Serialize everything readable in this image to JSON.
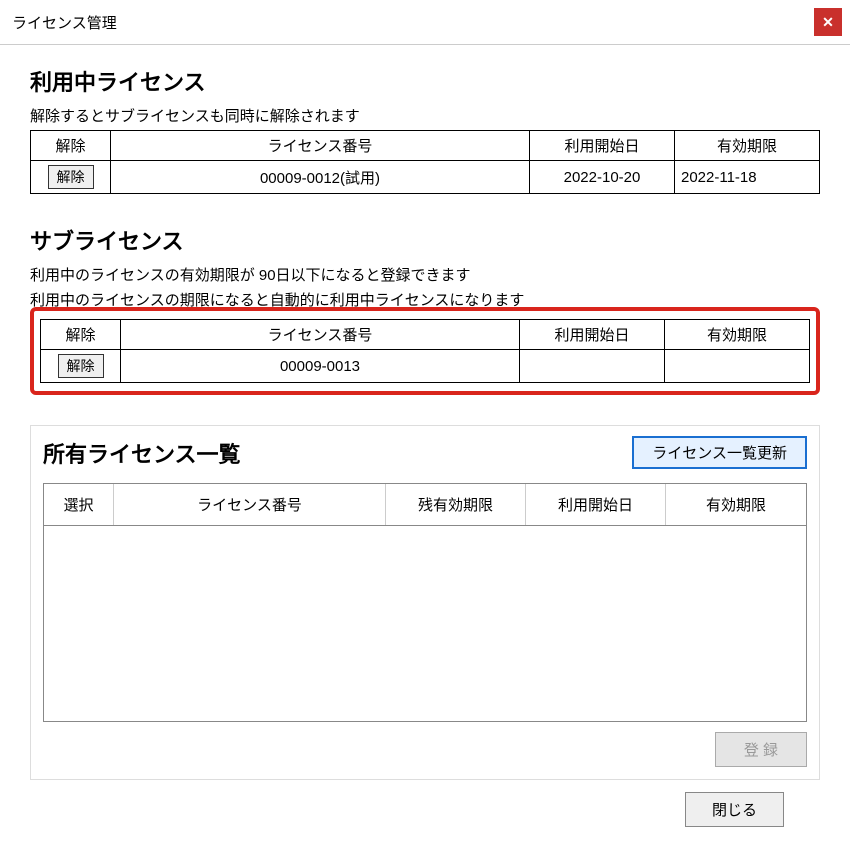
{
  "window": {
    "title": "ライセンス管理"
  },
  "active": {
    "title": "利用中ライセンス",
    "desc": "解除するとサブライセンスも同時に解除されます",
    "headers": {
      "remove": "解除",
      "number": "ライセンス番号",
      "start": "利用開始日",
      "expire": "有効期限"
    },
    "row": {
      "remove_label": "解除",
      "number": "00009-0012(試用)",
      "start": "2022-10-20",
      "expire": "2022-11-18"
    }
  },
  "sub": {
    "title": "サブライセンス",
    "desc1": "利用中のライセンスの有効期限が 90日以下になると登録できます",
    "desc2": "利用中のライセンスの期限になると自動的に利用中ライセンスになります",
    "headers": {
      "remove": "解除",
      "number": "ライセンス番号",
      "start": "利用開始日",
      "expire": "有効期限"
    },
    "row": {
      "remove_label": "解除",
      "number": "00009-0013",
      "start": "",
      "expire": ""
    }
  },
  "owned": {
    "title": "所有ライセンス一覧",
    "refresh_label": "ライセンス一覧更新",
    "headers": {
      "select": "選択",
      "number": "ライセンス番号",
      "remain": "残有効期限",
      "start": "利用開始日",
      "expire": "有効期限"
    },
    "register_label": "登 録"
  },
  "footer": {
    "close_label": "閉じる"
  }
}
